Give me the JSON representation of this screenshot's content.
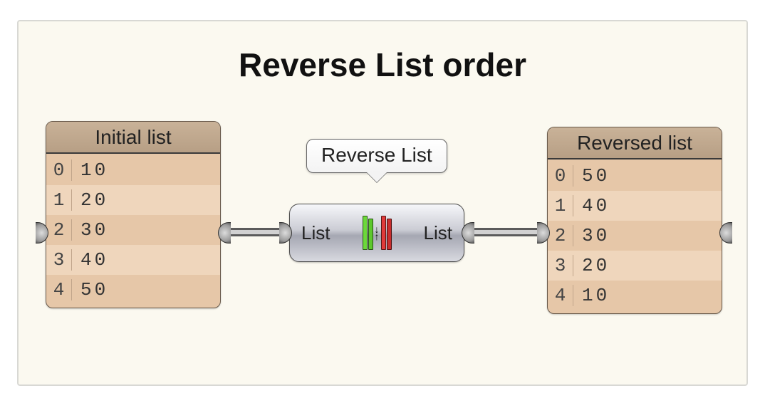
{
  "title": "Reverse List order",
  "tooltip": "Reverse List",
  "node": {
    "input_label": "List",
    "output_label": "List"
  },
  "initial_list": {
    "header": "Initial list",
    "rows": [
      {
        "index": "0",
        "value": "10"
      },
      {
        "index": "1",
        "value": "20"
      },
      {
        "index": "2",
        "value": "30"
      },
      {
        "index": "3",
        "value": "40"
      },
      {
        "index": "4",
        "value": "50"
      }
    ]
  },
  "reversed_list": {
    "header": "Reversed list",
    "rows": [
      {
        "index": "0",
        "value": "50"
      },
      {
        "index": "1",
        "value": "40"
      },
      {
        "index": "2",
        "value": "30"
      },
      {
        "index": "3",
        "value": "20"
      },
      {
        "index": "4",
        "value": "10"
      }
    ]
  }
}
